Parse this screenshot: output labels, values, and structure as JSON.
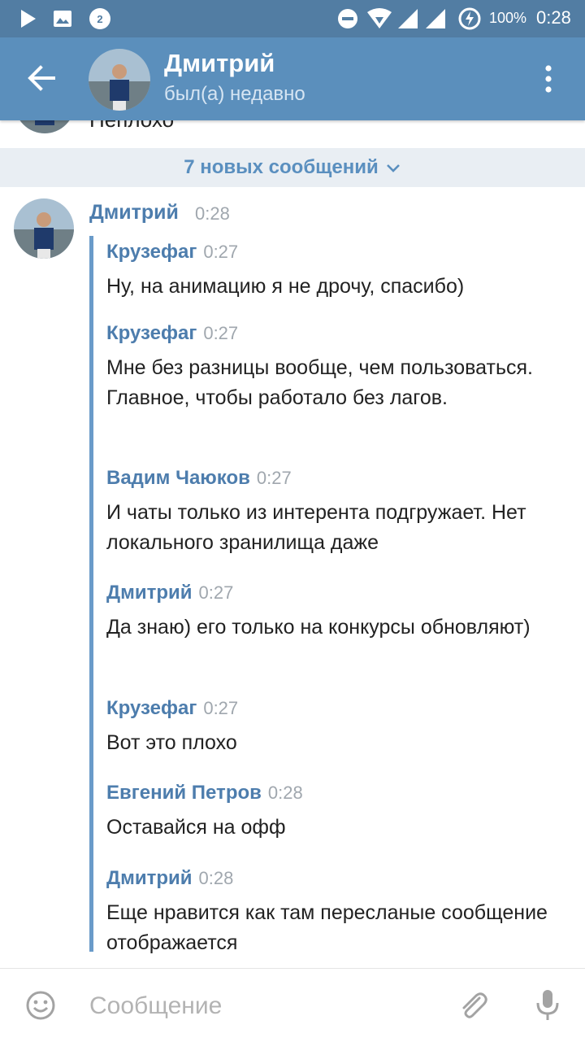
{
  "status_bar": {
    "battery": "100%",
    "time": "0:28",
    "notification_badge": "2",
    "icons": [
      "play-icon",
      "image-icon",
      "notification-icon",
      "do-not-disturb-icon",
      "wifi-icon",
      "signal-icon",
      "signal-icon",
      "battery-charging-icon"
    ]
  },
  "header": {
    "title": "Дмитрий",
    "status": "был(а) недавно"
  },
  "partial_message": {
    "text": "Неплохо"
  },
  "new_messages": {
    "label": "7 новых сообщений"
  },
  "message": {
    "sender": "Дмитрий",
    "time": "0:28",
    "forwarded": [
      {
        "name": "Крузефаг",
        "time": "0:27",
        "text": "Ну, на анимацию я не дрочу, спасибо)"
      },
      {
        "name": "Крузефаг",
        "time": "0:27",
        "text": "Мне без разницы вообще, чем пользоваться. Главное, чтобы работало без лагов."
      },
      {
        "name": "Вадим Чаюков",
        "time": "0:27",
        "text": "И чаты только из интерента подгружает. Нет локального зранилища даже"
      },
      {
        "name": "Дмитрий",
        "time": "0:27",
        "text": "Да знаю) его только на конкурсы обновляют)"
      },
      {
        "name": "Крузефаг",
        "time": "0:27",
        "text": "Вот это плохо"
      },
      {
        "name": "Евгений Петров",
        "time": "0:28",
        "text": "Оставайся на офф"
      },
      {
        "name": "Дмитрий",
        "time": "0:28",
        "text": "Еще нравится как там пересланые сообщение отображается"
      }
    ]
  },
  "input": {
    "placeholder": "Сообщение",
    "value": ""
  },
  "colors": {
    "status_bar": "#527da3",
    "app_bar": "#5b8fbc",
    "accent": "#4d7dad",
    "new_messages_bg": "#e9eef3"
  }
}
